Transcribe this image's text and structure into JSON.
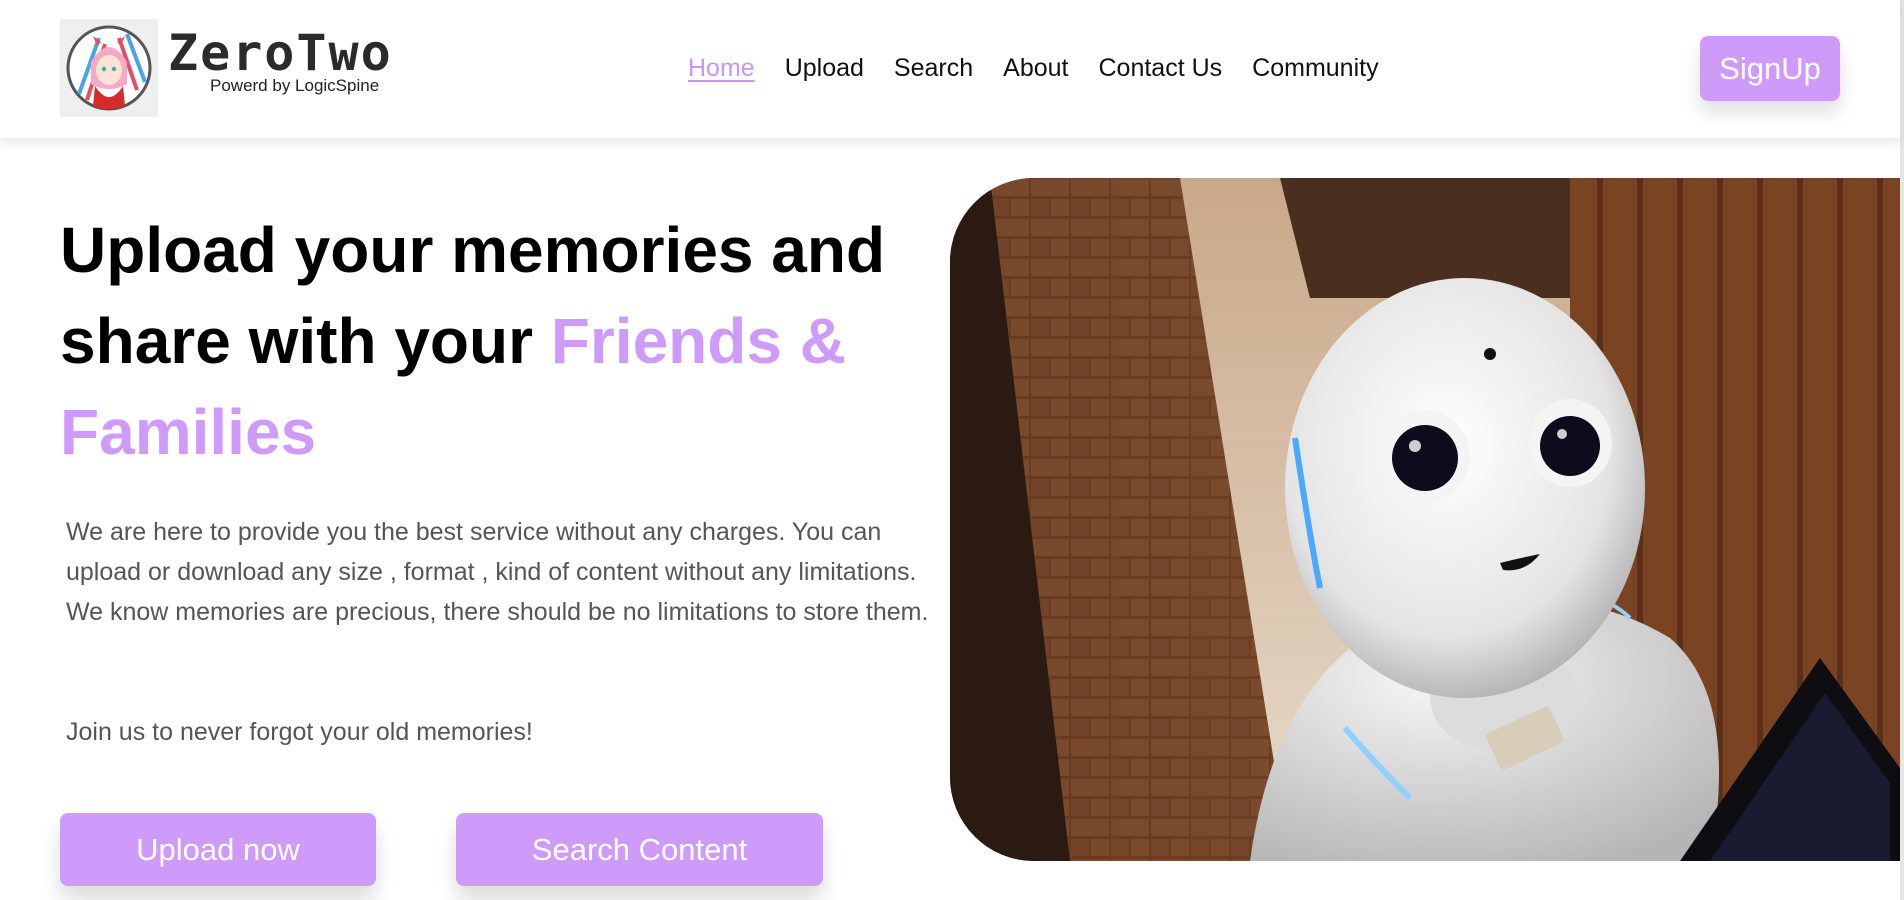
{
  "brand": {
    "name": "ZeroTwo",
    "tagline": "Powerd by LogicSpine",
    "logo_icon": "anime-avatar-icon"
  },
  "nav": {
    "items": [
      {
        "label": "Home",
        "active": true
      },
      {
        "label": "Upload",
        "active": false
      },
      {
        "label": "Search",
        "active": false
      },
      {
        "label": "About",
        "active": false
      },
      {
        "label": "Contact Us",
        "active": false
      },
      {
        "label": "Community",
        "active": false
      }
    ],
    "signup_label": "SignUp"
  },
  "hero": {
    "title_line1": "Upload your memories and share with your",
    "title_highlight": "Friends & Families",
    "description": "We are here to provide you the best service without any charges. You can upload or download any size , format , kind of content without any limitations. We know memories are precious, there should be no limitations to store them.",
    "join_text": "Join us to never forgot your old memories!",
    "upload_button": "Upload now",
    "search_button": "Search Content",
    "image_subject": "robot-photo"
  },
  "colors": {
    "accent": "#cf9bfb",
    "text_dark": "#000000",
    "text_body": "#555555"
  }
}
